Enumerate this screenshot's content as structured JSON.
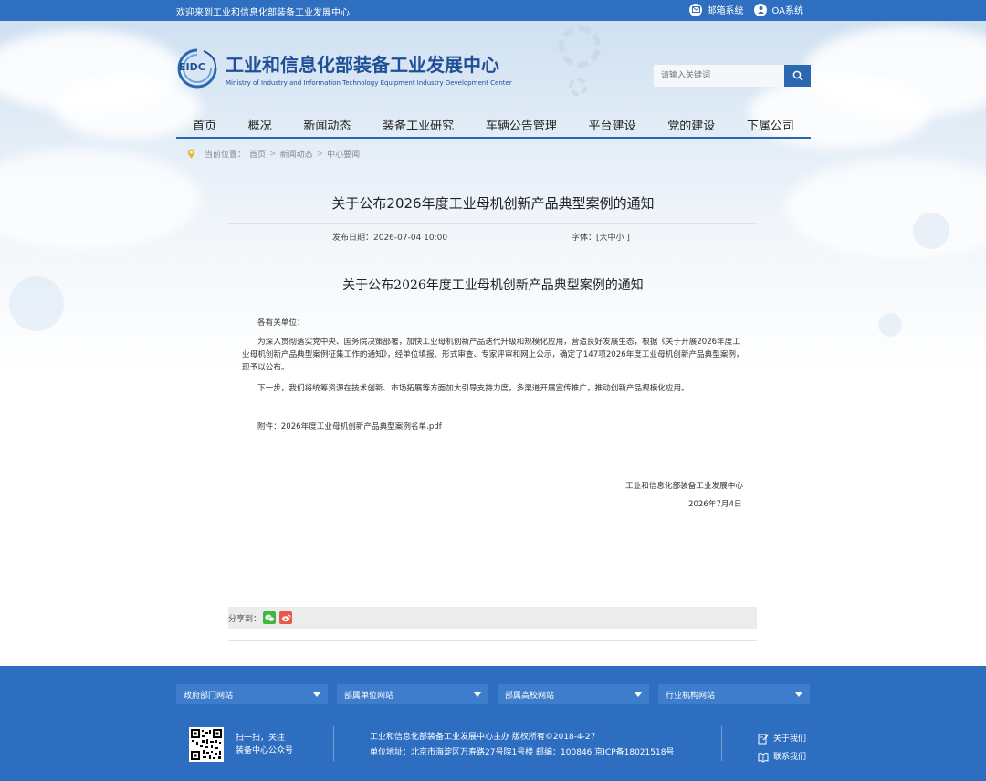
{
  "topbar": {
    "welcome": "欢迎来到工业和信息化部装备工业发展中心",
    "mail_label": "邮箱系统",
    "oa_label": "OA系统"
  },
  "logo": {
    "mark_text": "EIDC",
    "name_cn": "工业和信息化部装备工业发展中心",
    "name_en": "Ministry of Industry and Information Technology Equipment Industry Development Center"
  },
  "search": {
    "placeholder": "请输入关键词"
  },
  "nav": {
    "items": [
      {
        "label": "首页"
      },
      {
        "label": "概况"
      },
      {
        "label": "新闻动态"
      },
      {
        "label": "装备工业研究"
      },
      {
        "label": "车辆公告管理"
      },
      {
        "label": "平台建设"
      },
      {
        "label": "党的建设"
      },
      {
        "label": "下属公司"
      }
    ]
  },
  "breadcrumb": {
    "prefix": "当前位置：",
    "items": [
      "首页",
      "新闻动态",
      "中心要闻"
    ],
    "separator": ">"
  },
  "article": {
    "title": "关于公布2026年度工业母机创新产品典型案例的通知",
    "date_label": "发布日期：2026-07-04 10:00",
    "font_label": "字体：[大中小 ]",
    "doc_title": "关于公布2026年度工业母机创新产品典型案例的通知",
    "salutation": "各有关单位：",
    "para1": "为深入贯彻落实党中央、国务院决策部署，加快工业母机创新产品迭代升级和规模化应用，营造良好发展生态，根据《关于开展2026年度工业母机创新产品典型案例征集工作的通知》，经单位填报、形式审查、专家评审和网上公示，确定了147项2026年度工业母机创新产品典型案例，现予以公布。",
    "para2": "下一步，我们将统筹资源在技术创新、市场拓展等方面加大引导支持力度，多渠道开展宣传推广，推动创新产品规模化应用。",
    "attachment": "附件：2026年度工业母机创新产品典型案例名单.pdf",
    "sign_org": "工业和信息化部装备工业发展中心",
    "sign_date": "2026年7月4日"
  },
  "share": {
    "label": "分享到："
  },
  "footer": {
    "selects": [
      {
        "label": "政府部门网站"
      },
      {
        "label": "部属单位网站"
      },
      {
        "label": "部属高校网站"
      },
      {
        "label": "行业机构网站"
      }
    ],
    "qr_line1": "扫一扫，关注",
    "qr_line2": "装备中心公众号",
    "info_line1": "工业和信息化部装备工业发展中心主办  版权所有©2018-4-27",
    "info_line2": "单位地址：北京市海淀区万寿路27号院1号楼    邮编：100846  京ICP备18021518号",
    "about_label": "关于我们",
    "contact_label": "联系我们"
  },
  "colors": {
    "brand_blue": "#2c67b2",
    "footer_blue": "#2e6ec1",
    "wechat_green": "#3fb83e",
    "weibo_red": "#e8594a"
  }
}
